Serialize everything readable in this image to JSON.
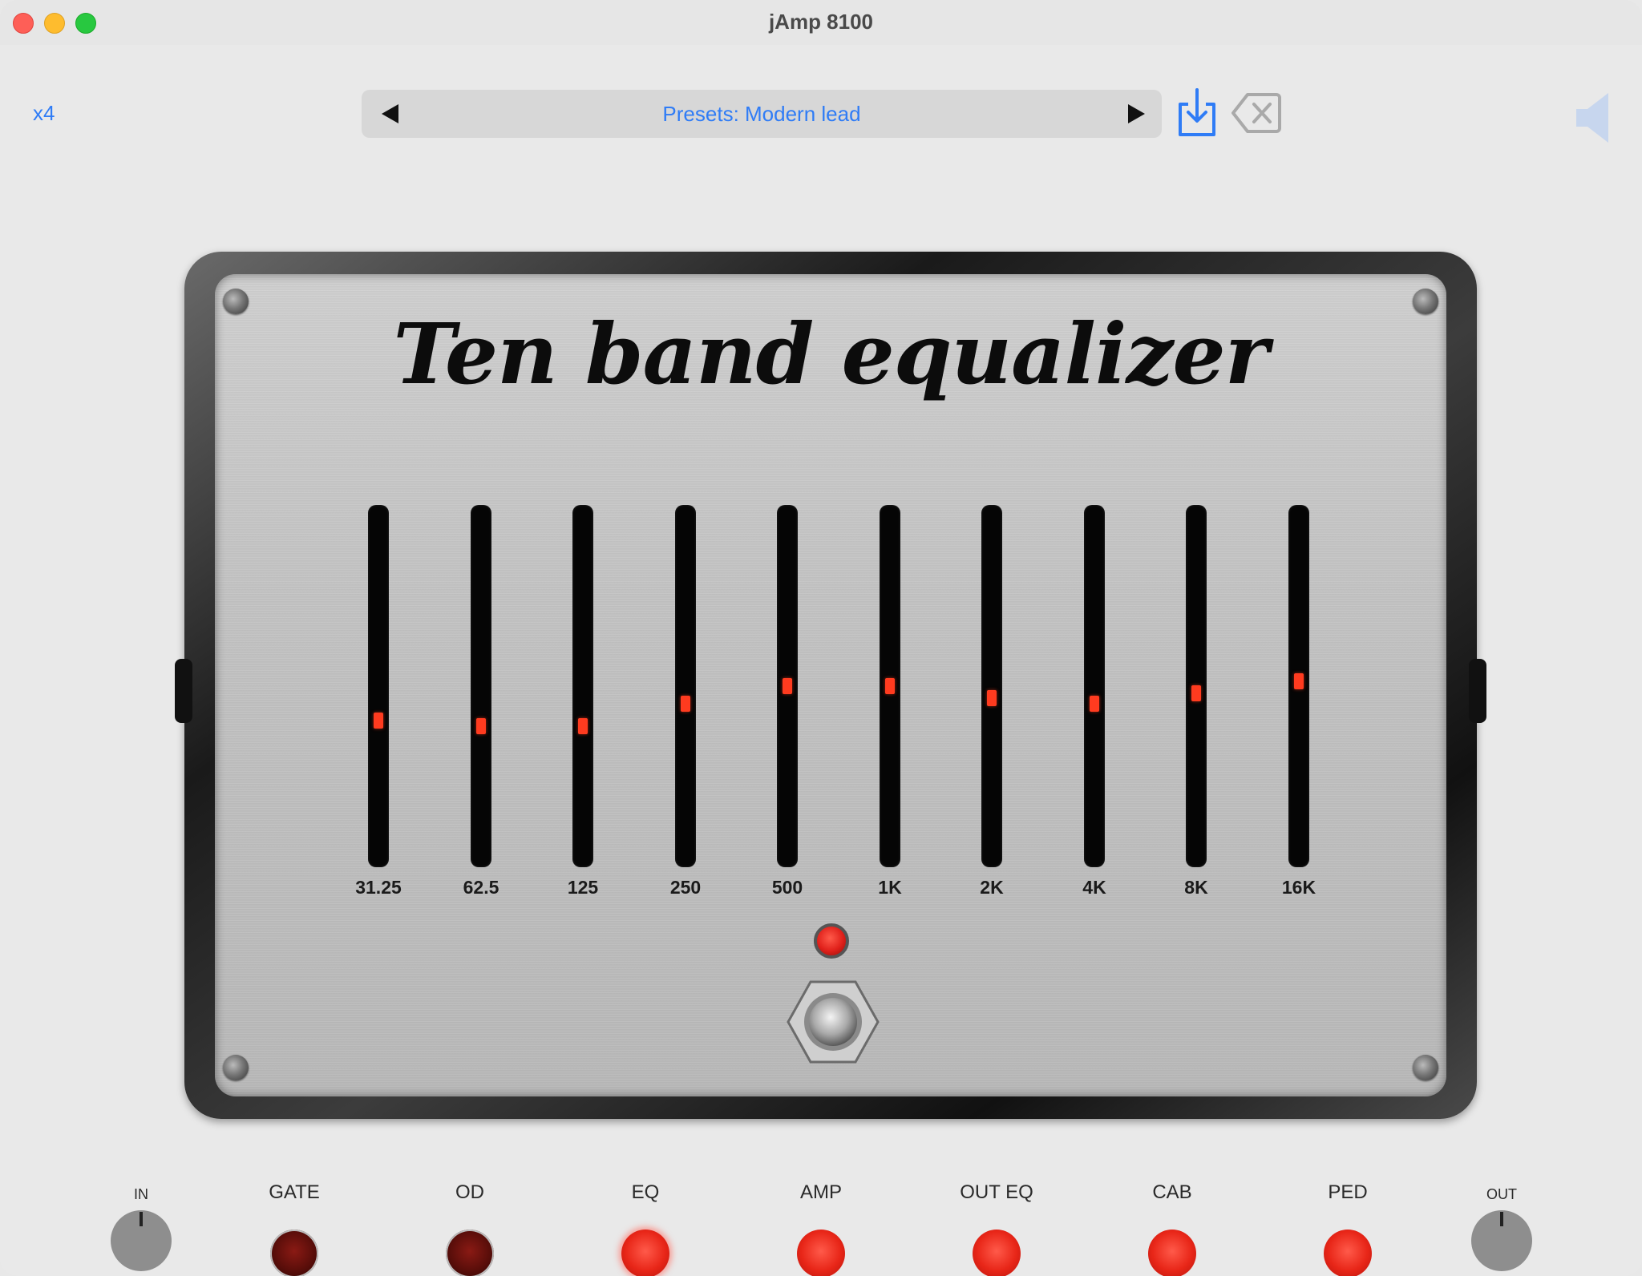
{
  "window": {
    "title": "jAmp 8100"
  },
  "toolbar": {
    "multiplier": "x4",
    "preset_label": "Presets: Modern lead",
    "icons": {
      "prev": "triangle-left-icon",
      "next": "triangle-right-icon",
      "save": "download-tray-icon",
      "delete": "backspace-x-icon",
      "volume": "speaker-icon"
    }
  },
  "pedal": {
    "title": "Ten band equalizer",
    "led_on": true,
    "bands": [
      {
        "label": "31.25",
        "level": 0.4
      },
      {
        "label": "62.5",
        "level": 0.385
      },
      {
        "label": "125",
        "level": 0.385
      },
      {
        "label": "250",
        "level": 0.45
      },
      {
        "label": "500",
        "level": 0.5
      },
      {
        "label": "1K",
        "level": 0.5
      },
      {
        "label": "2K",
        "level": 0.465
      },
      {
        "label": "4K",
        "level": 0.45
      },
      {
        "label": "8K",
        "level": 0.48
      },
      {
        "label": "16K",
        "level": 0.515
      }
    ]
  },
  "chain": {
    "input_label": "IN",
    "output_label": "OUT",
    "stages": [
      {
        "label": "GATE",
        "state": "off"
      },
      {
        "label": "OD",
        "state": "off"
      },
      {
        "label": "EQ",
        "state": "on-selected"
      },
      {
        "label": "AMP",
        "state": "on"
      },
      {
        "label": "OUT EQ",
        "state": "on"
      },
      {
        "label": "CAB",
        "state": "on"
      },
      {
        "label": "PED",
        "state": "on"
      }
    ]
  },
  "colors": {
    "accent": "#2f7cf6",
    "led_red": "#e82618",
    "led_dark": "#5a0e0a",
    "slider_thumb": "#ff3b1f"
  }
}
